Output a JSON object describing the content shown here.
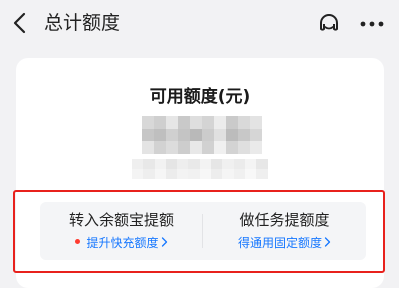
{
  "header": {
    "title": "总计额度",
    "back_icon": "back-arrow-icon",
    "service_icon": "customer-service-icon",
    "more_icon": "more-dots-icon"
  },
  "card": {
    "title": "可用额度(元)"
  },
  "actions": {
    "left": {
      "label": "转入余额宝提额",
      "sub_label": "提升快充额度",
      "has_red_dot": true
    },
    "right": {
      "label": "做任务提额度",
      "sub_label": "得通用固定额度"
    }
  },
  "colors": {
    "background": "#f2f2f4",
    "card": "#ffffff",
    "link": "#1677ff",
    "dot": "#ff3b30",
    "highlight": "#e8211c"
  }
}
